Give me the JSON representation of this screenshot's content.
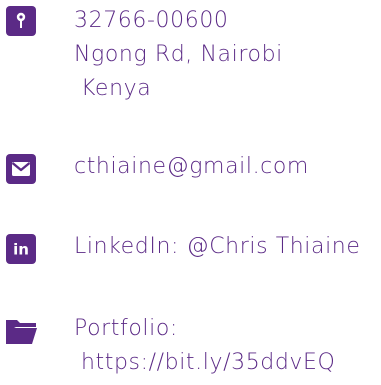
{
  "theme": {
    "accent": "#5b2a86",
    "icon_fg": "#ffffff"
  },
  "address": {
    "icon": "location-pin-icon",
    "line1": "32766-00600",
    "line2": "Ngong Rd, Nairobi",
    "line3": "Kenya"
  },
  "email": {
    "icon": "envelope-icon",
    "value": "cthiaine@gmail.com"
  },
  "linkedin": {
    "icon": "linkedin-icon",
    "icon_text": "in",
    "value": "LinkedIn: @Chris Thiaine"
  },
  "portfolio": {
    "icon": "folder-icon",
    "label": "Portfolio:",
    "url": "https://bit.ly/35ddvEQ"
  }
}
